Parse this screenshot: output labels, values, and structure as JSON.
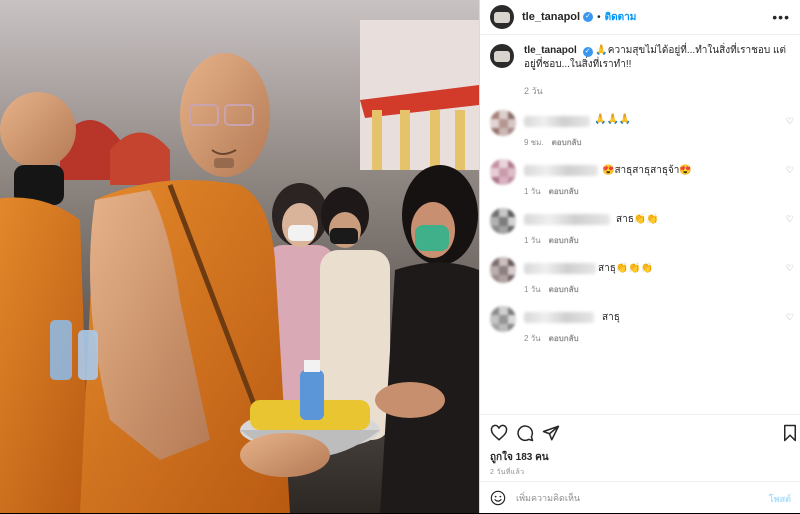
{
  "photo": {
    "description_icon": "photo"
  },
  "header": {
    "username": "tle_tanapol",
    "verified_icon": "verified-badge-icon",
    "separator": "•",
    "follow_label": "ติดตาม",
    "more_icon": "more-options-icon"
  },
  "caption": {
    "username": "tle_tanapol",
    "text": "🙏ความสุขไม่ได้อยู่ที่...ทำในสิ่งที่เราชอบ แต่อยู่ที่ชอบ...ในสิ่งที่เราทำ!!",
    "time": "2 วัน"
  },
  "comments": [
    {
      "text": "🙏🙏🙏",
      "time": "9 ชม.",
      "reply": "ตอบกลับ"
    },
    {
      "text": "😍สาธุสาธุสาธุจ้า😍",
      "time": "1 วัน",
      "reply": "ตอบกลับ"
    },
    {
      "text": "สาธ👏👏",
      "time": "1 วัน",
      "reply": "ตอบกลับ"
    },
    {
      "text": "สาธุ👏👏👏",
      "time": "1 วัน",
      "reply": "ตอบกลับ"
    },
    {
      "text": "สาธุ",
      "time": "2 วัน",
      "reply": "ตอบกลับ"
    }
  ],
  "actions": {
    "like_icon": "heart-icon",
    "comment_icon": "comment-icon",
    "share_icon": "send-icon",
    "save_icon": "bookmark-icon"
  },
  "likes": {
    "label": "ถูกใจ",
    "count": "183 คน"
  },
  "post_time": "2 วันที่แล้ว",
  "add_comment": {
    "placeholder": "เพิ่มความคิดเห็น",
    "post_label": "โพสต์"
  },
  "colors": {
    "accent": "#0095f6",
    "robe": "#d8731c",
    "text": "#262626",
    "muted": "#8e8e8e"
  }
}
